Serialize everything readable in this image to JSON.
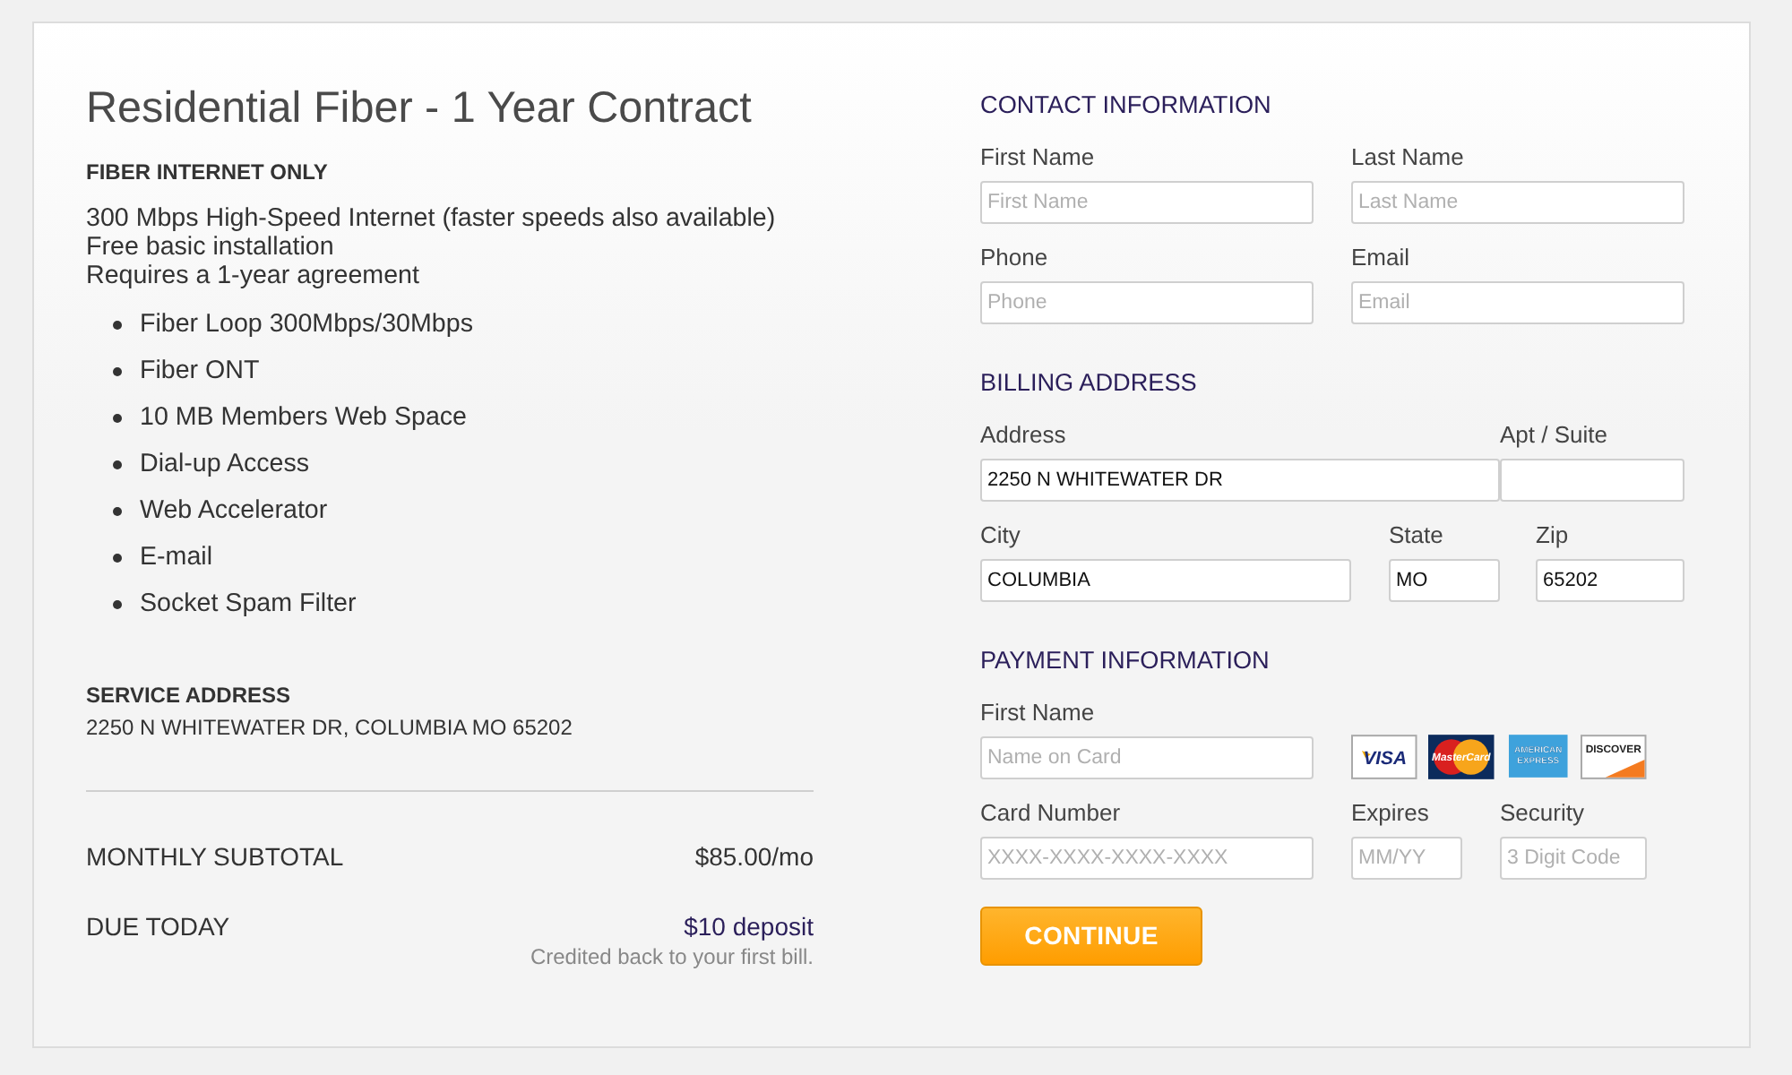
{
  "order": {
    "title": "Residential Fiber - 1 Year Contract",
    "plan_type": "FIBER INTERNET ONLY",
    "description": [
      "300 Mbps High-Speed Internet (faster speeds also available)",
      "Free basic installation",
      "Requires a 1-year agreement"
    ],
    "features": [
      "Fiber Loop 300Mbps/30Mbps",
      "Fiber ONT",
      "10 MB Members Web Space",
      "Dial-up Access",
      "Web Accelerator",
      "E-mail",
      "Socket Spam Filter"
    ],
    "service_address": {
      "label": "SERVICE ADDRESS",
      "value": "2250 N WHITEWATER DR, COLUMBIA MO 65202"
    },
    "totals": [
      {
        "label": "MONTHLY SUBTOTAL",
        "amount": "$85.00/mo",
        "highlighted": false
      },
      {
        "label": "DUE TODAY",
        "amount": "$10 deposit",
        "highlighted": true,
        "note": "Credited back to your first bill."
      }
    ]
  },
  "form": {
    "sections": [
      {
        "heading": "CONTACT INFORMATION",
        "fields": [
          {
            "label": "First Name",
            "placeholder": "First Name"
          },
          {
            "label": "Last Name",
            "placeholder": "Last Name"
          },
          {
            "label": "Phone",
            "placeholder": "Phone"
          },
          {
            "label": "Email",
            "placeholder": "Email"
          }
        ]
      },
      {
        "heading": "BILLING ADDRESS",
        "fields": [
          {
            "label": "Address",
            "value": "2250 N WHITEWATER DR"
          },
          {
            "label": "Apt / Suite"
          },
          {
            "label": "City",
            "value": "COLUMBIA"
          },
          {
            "label": "State",
            "value": "MO"
          },
          {
            "label": "Zip",
            "value": "65202"
          }
        ]
      },
      {
        "heading": "PAYMENT INFORMATION",
        "fields": [
          {
            "label": "First Name",
            "placeholder": "Name on Card"
          },
          {
            "label": "Card Number",
            "placeholder": "XXXX-XXXX-XXXX-XXXX"
          },
          {
            "label": "Expires",
            "placeholder": "MM/YY"
          },
          {
            "label": "Security",
            "placeholder": "3 Digit Code"
          }
        ],
        "card_logos": [
          {
            "kind": "visa",
            "text": [
              "VISA"
            ]
          },
          {
            "kind": "mastercard",
            "text": [
              "MasterCard"
            ]
          },
          {
            "kind": "amex",
            "text": [
              "AMERICAN",
              "EXPRESS"
            ]
          },
          {
            "kind": "discover",
            "text": [
              "DISCOVER"
            ]
          }
        ]
      }
    ],
    "continue_button": {
      "label": "CONTINUE"
    }
  }
}
